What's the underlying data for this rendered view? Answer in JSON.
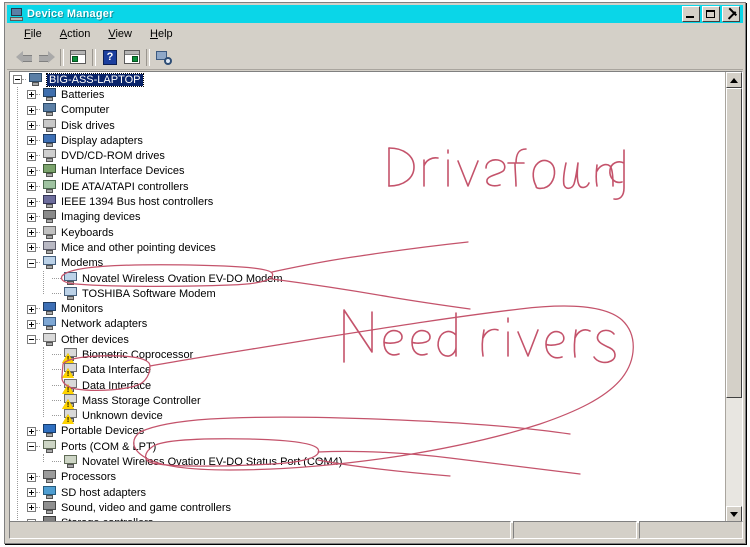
{
  "window": {
    "title": "Device Manager",
    "title_icon": "device-manager-icon",
    "buttons": {
      "minimize": "_",
      "maximize": "□",
      "close": "×"
    }
  },
  "menu": {
    "items": [
      "File",
      "Action",
      "View",
      "Help"
    ]
  },
  "toolbar": {
    "items": [
      {
        "name": "back-button",
        "icon": "back-arrow-icon"
      },
      {
        "name": "forward-button",
        "icon": "forward-arrow-icon"
      },
      {
        "name": "show-hide-console-tree-button",
        "icon": "console-tree-icon"
      },
      {
        "name": "help-button",
        "icon": "help-question-icon"
      },
      {
        "name": "properties-button",
        "icon": "properties-panel-icon"
      },
      {
        "name": "scan-for-hardware-changes-button",
        "icon": "scan-hardware-icon"
      }
    ],
    "help_glyph": "?"
  },
  "tree": {
    "root": {
      "label": "BIG-ASS-LAPTOP",
      "selected": true,
      "expanded": true,
      "icon": "computer-icon"
    },
    "nodes": [
      {
        "label": "Batteries",
        "icon": "battery-icon",
        "state": "collapsed",
        "depth": 1
      },
      {
        "label": "Computer",
        "icon": "computer-icon",
        "state": "collapsed",
        "depth": 1
      },
      {
        "label": "Disk drives",
        "icon": "disk-drive-icon",
        "state": "collapsed",
        "depth": 1
      },
      {
        "label": "Display adapters",
        "icon": "display-adapter-icon",
        "state": "collapsed",
        "depth": 1
      },
      {
        "label": "DVD/CD-ROM drives",
        "icon": "dvd-drive-icon",
        "state": "collapsed",
        "depth": 1
      },
      {
        "label": "Human Interface Devices",
        "icon": "hid-icon",
        "state": "collapsed",
        "depth": 1
      },
      {
        "label": "IDE ATA/ATAPI controllers",
        "icon": "ide-controller-icon",
        "state": "collapsed",
        "depth": 1
      },
      {
        "label": "IEEE 1394 Bus host controllers",
        "icon": "ieee1394-icon",
        "state": "collapsed",
        "depth": 1
      },
      {
        "label": "Imaging devices",
        "icon": "imaging-device-icon",
        "state": "collapsed",
        "depth": 1
      },
      {
        "label": "Keyboards",
        "icon": "keyboard-icon",
        "state": "collapsed",
        "depth": 1
      },
      {
        "label": "Mice and other pointing devices",
        "icon": "mouse-icon",
        "state": "collapsed",
        "depth": 1
      },
      {
        "label": "Modems",
        "icon": "modem-icon",
        "state": "expanded",
        "depth": 1
      },
      {
        "label": "Novatel Wireless Ovation EV-DO Modem",
        "icon": "modem-icon",
        "state": "leaf",
        "depth": 2
      },
      {
        "label": "TOSHIBA Software Modem",
        "icon": "modem-icon",
        "state": "leaf",
        "depth": 2
      },
      {
        "label": "Monitors",
        "icon": "monitor-icon",
        "state": "collapsed",
        "depth": 1
      },
      {
        "label": "Network adapters",
        "icon": "network-adapter-icon",
        "state": "collapsed",
        "depth": 1
      },
      {
        "label": "Other devices",
        "icon": "unknown-device-icon",
        "state": "expanded",
        "depth": 1
      },
      {
        "label": "Biometric Coprocessor",
        "icon": "unknown-device-icon",
        "state": "leaf",
        "depth": 2,
        "warning": true
      },
      {
        "label": "Data Interface",
        "icon": "unknown-device-icon",
        "state": "leaf",
        "depth": 2,
        "warning": true
      },
      {
        "label": "Data Interface",
        "icon": "unknown-device-icon",
        "state": "leaf",
        "depth": 2,
        "warning": true
      },
      {
        "label": "Mass Storage Controller",
        "icon": "unknown-device-icon",
        "state": "leaf",
        "depth": 2,
        "warning": true
      },
      {
        "label": "Unknown device",
        "icon": "unknown-device-icon",
        "state": "leaf",
        "depth": 2,
        "warning": true
      },
      {
        "label": "Portable Devices",
        "icon": "portable-device-icon",
        "state": "collapsed",
        "depth": 1
      },
      {
        "label": "Ports (COM & LPT)",
        "icon": "port-icon",
        "state": "expanded",
        "depth": 1
      },
      {
        "label": "Novatel Wireless Ovation EV-DO Status Port (COM4)",
        "icon": "port-icon",
        "state": "leaf",
        "depth": 2
      },
      {
        "label": "Processors",
        "icon": "processor-icon",
        "state": "collapsed",
        "depth": 1
      },
      {
        "label": "SD host adapters",
        "icon": "sd-adapter-icon",
        "state": "collapsed",
        "depth": 1
      },
      {
        "label": "Sound, video and game controllers",
        "icon": "sound-controller-icon",
        "state": "collapsed",
        "depth": 1
      },
      {
        "label": "Storage controllers",
        "icon": "storage-controller-icon",
        "state": "collapsed",
        "depth": 1
      }
    ]
  },
  "annotations": {
    "ink_color": "#c4536b",
    "notes": [
      {
        "name": "drivers-found-note",
        "text": "Drivers found"
      },
      {
        "name": "need-drivers-note",
        "text": "Need drivers"
      }
    ]
  },
  "statusbar": {
    "panels": [
      "",
      "",
      ""
    ]
  },
  "scrollbar": {
    "up_glyph": "▲",
    "down_glyph": "▼"
  }
}
